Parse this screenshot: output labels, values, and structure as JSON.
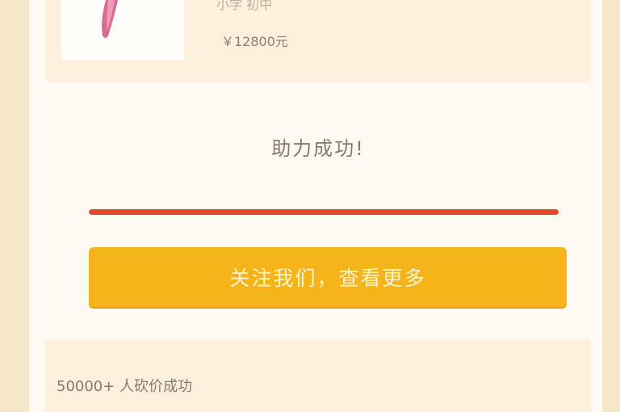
{
  "product": {
    "subtitle": "小学 初中",
    "price": "￥12800元"
  },
  "status": {
    "title": "助力成功!",
    "progress": 1.0
  },
  "actions": {
    "follow_label": "关注我们，查看更多"
  },
  "stats": {
    "count_text": "50000+ 人砍价成功"
  },
  "colors": {
    "page_background": "#fffaf1",
    "card_background": "#fdf0dd",
    "progress_fill": "#e04a2a",
    "button_background": "#f4b41a",
    "button_text": "#fff4cf"
  }
}
